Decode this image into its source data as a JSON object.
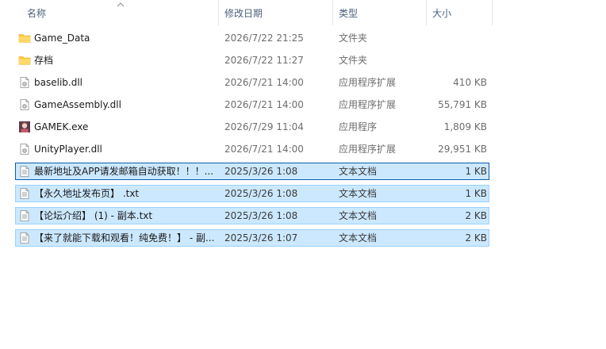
{
  "header": {
    "name": "名称",
    "date_modified": "修改日期",
    "type": "类型",
    "size": "大小",
    "sort_icon": "chevron-up-icon"
  },
  "files": [
    {
      "name": "Game_Data",
      "date": "2026/7/22 21:25",
      "type": "文件夹",
      "size": "",
      "icon": "folder-icon",
      "selected": false
    },
    {
      "name": "存档",
      "date": "2026/7/22 11:27",
      "type": "文件夹",
      "size": "",
      "icon": "folder-icon",
      "selected": false
    },
    {
      "name": "baselib.dll",
      "date": "2026/7/21 14:00",
      "type": "应用程序扩展",
      "size": "410 KB",
      "icon": "dll-file-icon",
      "selected": false
    },
    {
      "name": "GameAssembly.dll",
      "date": "2026/7/21 14:00",
      "type": "应用程序扩展",
      "size": "55,791 KB",
      "icon": "dll-file-icon",
      "selected": false
    },
    {
      "name": "GAMEK.exe",
      "date": "2026/7/29 11:04",
      "type": "应用程序",
      "size": "1,809 KB",
      "icon": "exe-app-icon",
      "selected": false
    },
    {
      "name": "UnityPlayer.dll",
      "date": "2026/7/21 14:00",
      "type": "应用程序扩展",
      "size": "29,951 KB",
      "icon": "dll-file-icon",
      "selected": false
    },
    {
      "name": "最新地址及APP请发邮箱自动获取！！！...",
      "date": "2025/3/26 1:08",
      "type": "文本文档",
      "size": "1 KB",
      "icon": "text-file-icon",
      "selected": true
    },
    {
      "name": "【永久地址发布页】 .txt",
      "date": "2025/3/26 1:08",
      "type": "文本文档",
      "size": "1 KB",
      "icon": "text-file-icon",
      "selected": true
    },
    {
      "name": "【论坛介绍】 (1) - 副本.txt",
      "date": "2025/3/26 1:08",
      "type": "文本文档",
      "size": "2 KB",
      "icon": "text-file-icon",
      "selected": true
    },
    {
      "name": "【来了就能下载和观看！纯免费！】 - 副...",
      "date": "2025/3/26 1:07",
      "type": "文本文档",
      "size": "2 KB",
      "icon": "text-file-icon",
      "selected": true
    }
  ],
  "colors": {
    "selection_bg": "#cce8ff",
    "selection_border": "#99d1ff",
    "focus_border": "#0b5ea8",
    "folder": "#ffc83d",
    "header_text": "#4c607a"
  }
}
